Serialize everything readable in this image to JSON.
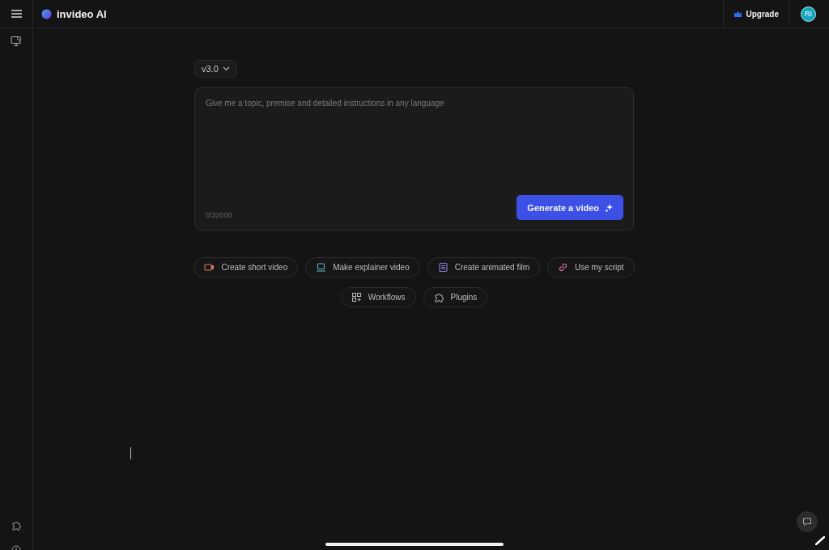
{
  "topbar": {
    "brand": "invideo AI",
    "upgrade": "Upgrade",
    "avatar": "RI"
  },
  "version": "v3.0",
  "prompt": {
    "placeholder": "Give me a topic, premise and detailed instructions in any language",
    "counter": "0/32000",
    "button": "Generate a video"
  },
  "chips": [
    {
      "label": "Create short video",
      "kind": "camera",
      "color": "#d9785f"
    },
    {
      "label": "Make explainer video",
      "kind": "screen",
      "color": "#5fb3c9"
    },
    {
      "label": "Create animated film",
      "kind": "doc",
      "color": "#8f7be0"
    },
    {
      "label": "Use my script",
      "kind": "link",
      "color": "#d86aa8"
    }
  ],
  "extras": [
    {
      "label": "Workflows",
      "kind": "grid"
    },
    {
      "label": "Plugins",
      "kind": "puzzle"
    }
  ]
}
